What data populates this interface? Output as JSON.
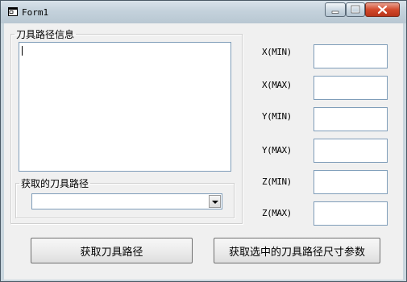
{
  "window": {
    "title": "Form1"
  },
  "groups": {
    "path_info_legend": "刀具路径信息",
    "selected_path_legend": "获取的刀具路径"
  },
  "path_info_text": "",
  "selected_path_value": "",
  "fields": [
    {
      "label": "X(MIN)",
      "value": ""
    },
    {
      "label": "X(MAX)",
      "value": ""
    },
    {
      "label": "Y(MIN)",
      "value": ""
    },
    {
      "label": "Y(MAX)",
      "value": ""
    },
    {
      "label": "Z(MIN)",
      "value": ""
    },
    {
      "label": "Z(MAX)",
      "value": ""
    }
  ],
  "buttons": {
    "get_path": "获取刀具路径",
    "get_selected_dims": "获取选中的刀具路径尺寸参数"
  },
  "icons": {
    "app": "form-app-icon",
    "minimize": "minimize-icon",
    "maximize": "maximize-icon",
    "close": "close-icon",
    "dropdown": "chevron-down-icon"
  }
}
